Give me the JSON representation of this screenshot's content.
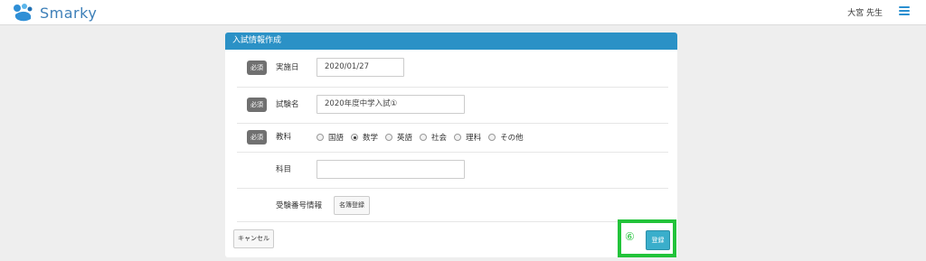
{
  "header": {
    "brand": "Smarky",
    "user_name": "大宮 先生"
  },
  "panel": {
    "title": "入試情報作成"
  },
  "form": {
    "required_badge": "必須",
    "date": {
      "label": "実施日",
      "value": "2020/01/27"
    },
    "exam_name": {
      "label": "試験名",
      "value": "2020年度中学入試①"
    },
    "subject": {
      "label": "教科",
      "options": [
        "国語",
        "数学",
        "英語",
        "社会",
        "理科",
        "その他"
      ],
      "selected": "数学"
    },
    "course": {
      "label": "科目",
      "value": ""
    },
    "examinee_number": {
      "label": "受験番号情報",
      "button": "名簿登録"
    }
  },
  "actions": {
    "cancel": "キャンセル",
    "register": "登録"
  },
  "annotation": {
    "step": "⑥",
    "color": "#22c33a"
  },
  "colors": {
    "header_blue": "#2b91c6",
    "brand_blue": "#3d7fb8",
    "register_teal": "#3aaecb"
  }
}
